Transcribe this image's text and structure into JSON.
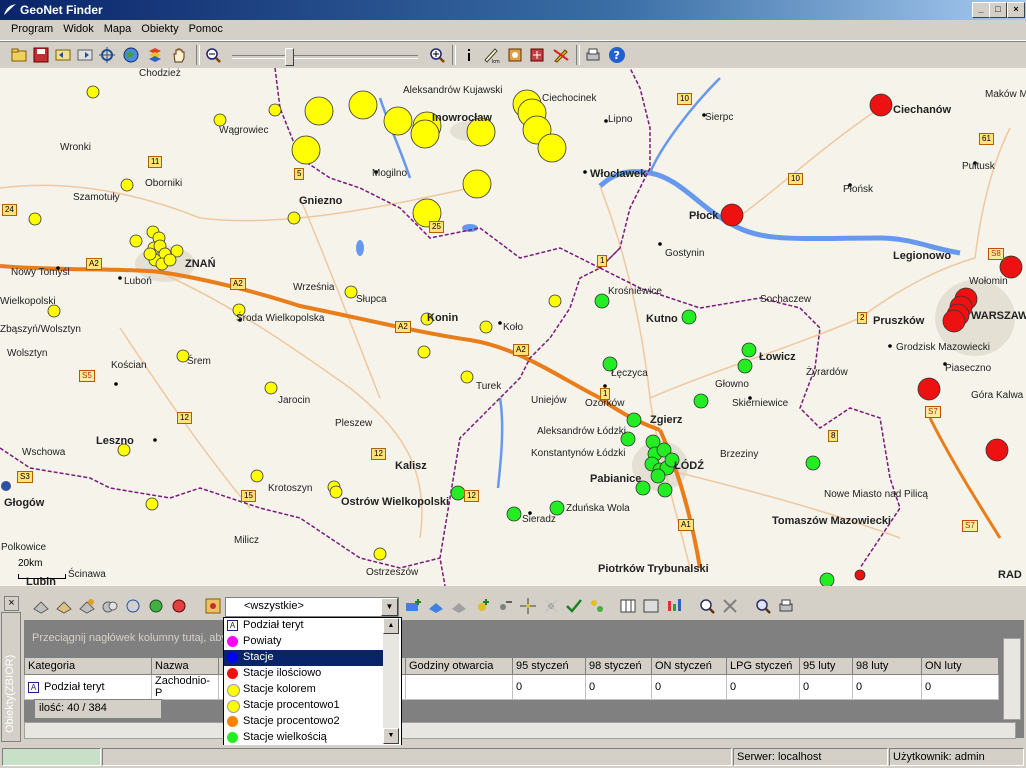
{
  "window": {
    "title": "GeoNet Finder",
    "buttons": {
      "minimize": "_",
      "maximize": "□",
      "close": "×"
    }
  },
  "menu": [
    "Program",
    "Widok",
    "Mapa",
    "Obiekty",
    "Pomoc"
  ],
  "toolbar": {
    "icons": [
      "open-project-icon",
      "save-icon",
      "back-icon",
      "forward-icon",
      "center-icon",
      "globe-icon",
      "layers-icon",
      "pan-hand-icon",
      "zoom-out-icon",
      "zoom-in-icon",
      "info-icon",
      "measure-icon",
      "select-icon",
      "label-icon",
      "edit-icon",
      "print-icon",
      "help-icon"
    ],
    "zoom_level": 0.3
  },
  "map": {
    "cities": [
      {
        "name": "Chodzież",
        "bold": false
      },
      {
        "name": "Aleksandrów Kujawski",
        "bold": false
      },
      {
        "name": "Ciechocinek",
        "bold": false
      },
      {
        "name": "Ciechanów",
        "bold": true
      },
      {
        "name": "Maków M",
        "bold": false
      },
      {
        "name": "Wągrowiec",
        "bold": false
      },
      {
        "name": "Inowrocław",
        "bold": true
      },
      {
        "name": "Lipno",
        "bold": false
      },
      {
        "name": "Sierpc",
        "bold": false
      },
      {
        "name": "Pułtusk",
        "bold": false
      },
      {
        "name": "Wronki",
        "bold": false
      },
      {
        "name": "Oborniki",
        "bold": false
      },
      {
        "name": "Szamotuły",
        "bold": false
      },
      {
        "name": "Mogilno",
        "bold": false
      },
      {
        "name": "Włocławek",
        "bold": true
      },
      {
        "name": "Płońsk",
        "bold": false
      },
      {
        "name": "Gniezno",
        "bold": true
      },
      {
        "name": "Płock",
        "bold": true
      },
      {
        "name": "Gostynin",
        "bold": false
      },
      {
        "name": "Legionowo",
        "bold": true
      },
      {
        "name": "Nowy Tomyśl",
        "bold": false
      },
      {
        "name": "Luboń",
        "bold": false
      },
      {
        "name": "ZNAŃ",
        "bold": true
      },
      {
        "name": "Września",
        "bold": false
      },
      {
        "name": "Słupca",
        "bold": false
      },
      {
        "name": "Krośniewice",
        "bold": false
      },
      {
        "name": "Sochaczew",
        "bold": false
      },
      {
        "name": "Wołomin",
        "bold": false
      },
      {
        "name": "Wielkopolski",
        "bold": false
      },
      {
        "name": "Środa Wielkopolska",
        "bold": false
      },
      {
        "name": "Konin",
        "bold": true
      },
      {
        "name": "Koło",
        "bold": false
      },
      {
        "name": "Kutno",
        "bold": true
      },
      {
        "name": "Pruszków",
        "bold": true
      },
      {
        "name": "WARSZAW",
        "bold": true
      },
      {
        "name": "Zbąszyń/Wolsztyn",
        "bold": false
      },
      {
        "name": "Wolsztyn",
        "bold": false
      },
      {
        "name": "Kościan",
        "bold": false
      },
      {
        "name": "Śrem",
        "bold": false
      },
      {
        "name": "Łęczyca",
        "bold": false
      },
      {
        "name": "Łowicz",
        "bold": true
      },
      {
        "name": "Grodzisk Mazowiecki",
        "bold": false
      },
      {
        "name": "Żyrardów",
        "bold": false
      },
      {
        "name": "Piaseczno",
        "bold": false
      },
      {
        "name": "Głowno",
        "bold": false
      },
      {
        "name": "Turek",
        "bold": false
      },
      {
        "name": "Jarocin",
        "bold": false
      },
      {
        "name": "Uniejów",
        "bold": false
      },
      {
        "name": "Ozorków",
        "bold": false
      },
      {
        "name": "Skierniewice",
        "bold": false
      },
      {
        "name": "Góra Kalwa",
        "bold": false
      },
      {
        "name": "Zgierz",
        "bold": true
      },
      {
        "name": "Pleszew",
        "bold": false
      },
      {
        "name": "Aleksandrów Łódzki",
        "bold": false
      },
      {
        "name": "Leszno",
        "bold": true
      },
      {
        "name": "Wschowa",
        "bold": false
      },
      {
        "name": "Konstantynów Łódzki",
        "bold": false
      },
      {
        "name": "ŁÓDŹ",
        "bold": true
      },
      {
        "name": "Brzeziny",
        "bold": false
      },
      {
        "name": "Kalisz",
        "bold": true
      },
      {
        "name": "Pabianice",
        "bold": true
      },
      {
        "name": "Krotoszyn",
        "bold": false
      },
      {
        "name": "Ostrów Wielkopolski",
        "bold": true
      },
      {
        "name": "Nowe Miasto nad Pilicą",
        "bold": false
      },
      {
        "name": "Głogów",
        "bold": true
      },
      {
        "name": "Zduńska Wola",
        "bold": false
      },
      {
        "name": "Sieradz",
        "bold": false
      },
      {
        "name": "Tomaszów Mazowiecki",
        "bold": true
      },
      {
        "name": "Milicz",
        "bold": false
      },
      {
        "name": "Polkowice",
        "bold": false
      },
      {
        "name": "Ostrzeszów",
        "bold": false
      },
      {
        "name": "Piotrków Trybunalski",
        "bold": true
      },
      {
        "name": "RAD",
        "bold": true
      },
      {
        "name": "Lubin",
        "bold": true
      },
      {
        "name": "Ścinawa",
        "bold": false
      }
    ],
    "road_labels": [
      "A2",
      "A2",
      "A2",
      "A2",
      "A1",
      "S8",
      "S7",
      "S7",
      "S5",
      "S3",
      "11",
      "10",
      "10",
      "1",
      "1",
      "12",
      "12",
      "12",
      "15",
      "24",
      "25",
      "8",
      "2",
      "61",
      "5"
    ],
    "scale_label": "20km",
    "colors": {
      "yellow": "#ffff00",
      "red": "#ee1111",
      "green": "#22ee22",
      "border": "#7a1a7a",
      "motorway": "#e87d1a",
      "water": "#6699ee"
    }
  },
  "panel": {
    "side_tab": "Obiekty(ZBIOR)",
    "filter_value": "<wszystkie>",
    "group_hint": "Przeciągnij nagłówek kolumny tutaj, aby",
    "columns": [
      "Kategoria",
      "Nazwa",
      "",
      "Godziny otwarcia",
      "95 styczeń",
      "98 styczeń",
      "ON styczeń",
      "LPG styczeń",
      "95 luty",
      "98 luty",
      "ON luty"
    ],
    "rows": [
      [
        "Podział teryt",
        "Zachodnio-P",
        "",
        "",
        "0",
        "0",
        "0",
        "0",
        "0",
        "0",
        "0"
      ]
    ],
    "count": "ilość: 40 / 384",
    "dropdown": [
      {
        "label": "Podział teryt",
        "icon": "category-a-icon",
        "color": "#ffffff"
      },
      {
        "label": "Powiaty",
        "icon": "circle-icon",
        "color": "#ff00ff"
      },
      {
        "label": "Stacje",
        "icon": "circle-icon",
        "color": "#0000ff",
        "selected": true
      },
      {
        "label": "Stacje ilościowo",
        "icon": "circle-icon",
        "color": "#ee1111"
      },
      {
        "label": "Stacje kolorem",
        "icon": "circle-icon",
        "color": "#ffff00"
      },
      {
        "label": "Stacje procentowo1",
        "icon": "circle-icon",
        "color": "#ffff00"
      },
      {
        "label": "Stacje procentowo2",
        "icon": "circle-icon",
        "color": "#ff8000"
      },
      {
        "label": "Stacje wielkością",
        "icon": "circle-icon",
        "color": "#22ee22"
      }
    ]
  },
  "status": {
    "main": "",
    "server": "Serwer: localhost",
    "user": "Użytkownik: admin"
  }
}
